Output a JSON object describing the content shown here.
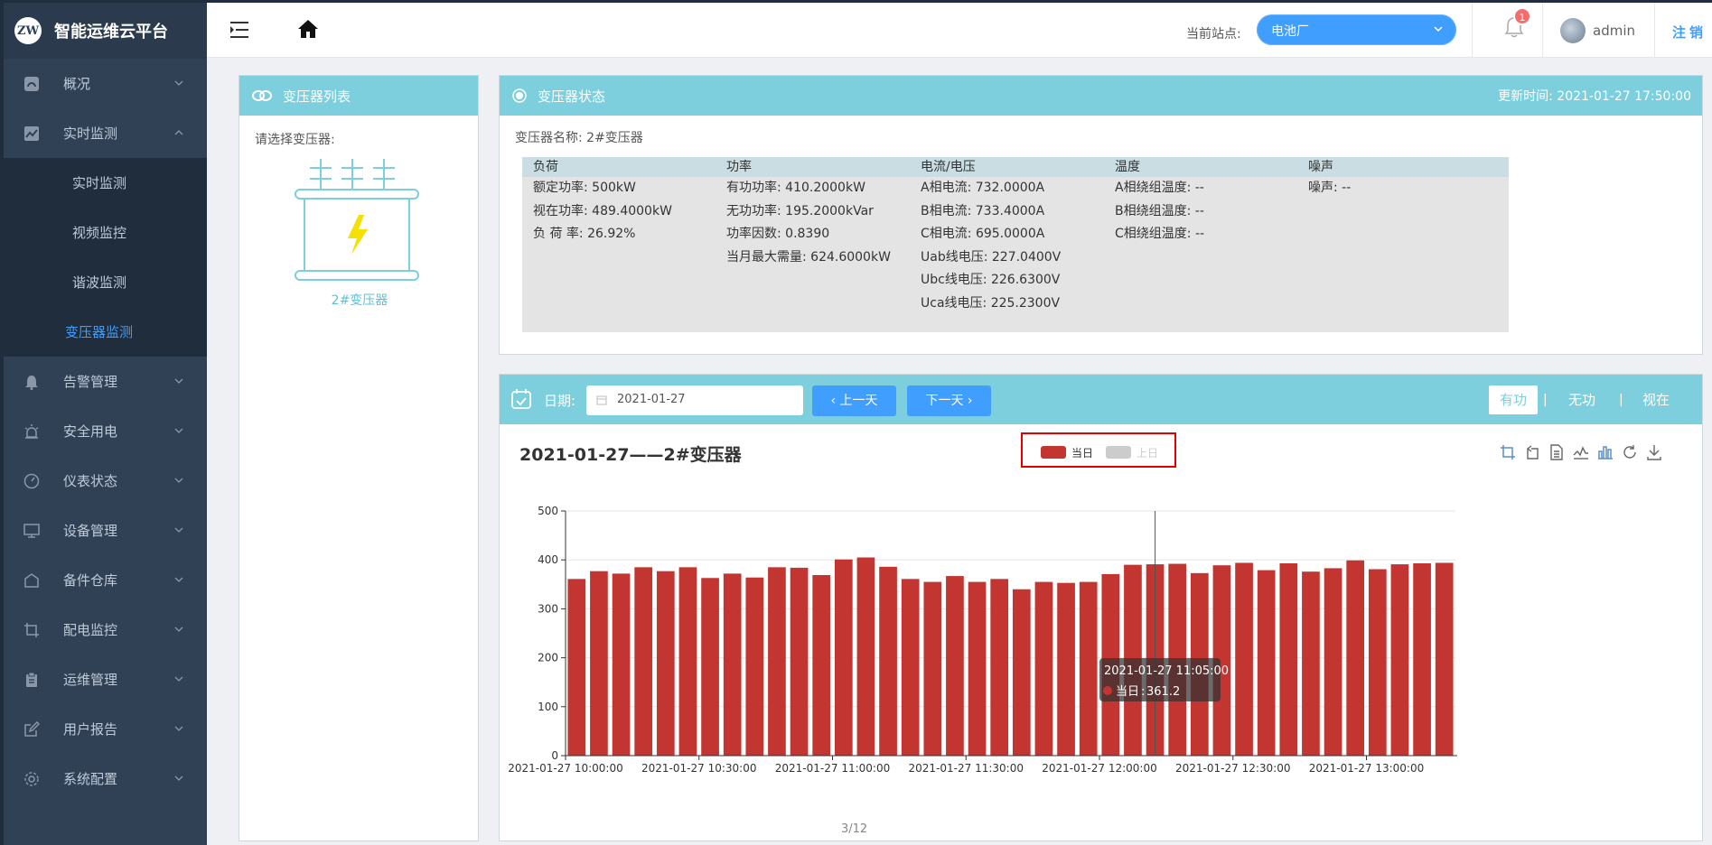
{
  "app": {
    "logo_text": "ZW",
    "title": "智能运维云平台"
  },
  "sidebar": {
    "items": [
      {
        "label": "概况",
        "icon": "dashboard-icon"
      },
      {
        "label": "实时监测",
        "icon": "chart-icon",
        "expanded": true,
        "children": [
          {
            "label": "实时监测"
          },
          {
            "label": "视频监控"
          },
          {
            "label": "谐波监测"
          },
          {
            "label": "变压器监测",
            "active": true
          }
        ]
      },
      {
        "label": "告警管理",
        "icon": "bell-icon"
      },
      {
        "label": "安全用电",
        "icon": "alarm-light-icon"
      },
      {
        "label": "仪表状态",
        "icon": "gauge-icon"
      },
      {
        "label": "设备管理",
        "icon": "monitor-icon"
      },
      {
        "label": "备件仓库",
        "icon": "warehouse-icon"
      },
      {
        "label": "配电监控",
        "icon": "crop-icon"
      },
      {
        "label": "运维管理",
        "icon": "clipboard-icon"
      },
      {
        "label": "用户报告",
        "icon": "edit-icon"
      },
      {
        "label": "系统配置",
        "icon": "settings-icon"
      }
    ]
  },
  "header": {
    "station_label": "当前站点:",
    "station_value": "电池厂",
    "notification_count": "1",
    "username": "admin",
    "logout": "注销"
  },
  "list_panel": {
    "title": "变压器列表",
    "prompt": "请选择变压器:",
    "transformer_name": "2#变压器"
  },
  "status_panel": {
    "title": "变压器状态",
    "update_time": "更新时间: 2021-01-27 17:50:00",
    "transformer_name_line": "变压器名称: 2#变压器",
    "boxes": [
      {
        "title": "负荷",
        "lines": [
          "额定功率: 500kW",
          "视在功率: 489.4000kW",
          "负 荷 率: 26.92%"
        ]
      },
      {
        "title": "功率",
        "lines": [
          "有功功率: 410.2000kW",
          "无功功率: 195.2000kVar",
          "功率因数: 0.8390",
          "当月最大需量: 624.6000kW"
        ]
      },
      {
        "title": "电流/电压",
        "lines": [
          "A相电流: 732.0000A",
          "B相电流: 733.4000A",
          "C相电流: 695.0000A",
          "Uab线电压: 227.0400V",
          "Ubc线电压: 226.6300V",
          "Uca线电压: 225.2300V"
        ]
      },
      {
        "title": "温度",
        "lines": [
          "A相绕组温度: --",
          "B相绕组温度: --",
          "C相绕组温度: --"
        ]
      },
      {
        "title": "噪声",
        "lines": [
          "噪声: --"
        ]
      }
    ]
  },
  "chart_panel": {
    "date_label": "日期:",
    "date_value": "2021-01-27",
    "prev_day": "上一天",
    "next_day": "下一天",
    "modes": [
      "有功",
      "无功",
      "视在"
    ],
    "active_mode": "有功",
    "page_indicator": "3/12"
  },
  "chart_data": {
    "type": "bar",
    "title": "2021-01-27——2#变压器",
    "legend": [
      {
        "name": "当日",
        "color": "#c23531",
        "enabled": true
      },
      {
        "name": "上日",
        "color": "#cccccc",
        "enabled": false
      }
    ],
    "legend_position": "top-center",
    "ylim": [
      0,
      500
    ],
    "yticks": [
      0,
      100,
      200,
      300,
      400,
      500
    ],
    "xtick_labels": [
      "2021-01-27 10:00:00",
      "2021-01-27 10:30:00",
      "2021-01-27 11:00:00",
      "2021-01-27 11:30:00",
      "2021-01-27 12:00:00",
      "2021-01-27 12:30:00",
      "2021-01-27 13:00:00"
    ],
    "series": [
      {
        "name": "当日",
        "color": "#c23531",
        "values": [
          361,
          377,
          372,
          385,
          377,
          385,
          363,
          372,
          364,
          385,
          384,
          369,
          401,
          405,
          386,
          361,
          355,
          367,
          355,
          361,
          340,
          355,
          353,
          355,
          371,
          390,
          391,
          392,
          373,
          389,
          394,
          379,
          393,
          376,
          383,
          399,
          381,
          391,
          393,
          394
        ]
      }
    ],
    "grid": true,
    "tooltip": {
      "title": "2021-01-27 11:05:00",
      "series": "当日",
      "value": "361.2"
    }
  }
}
